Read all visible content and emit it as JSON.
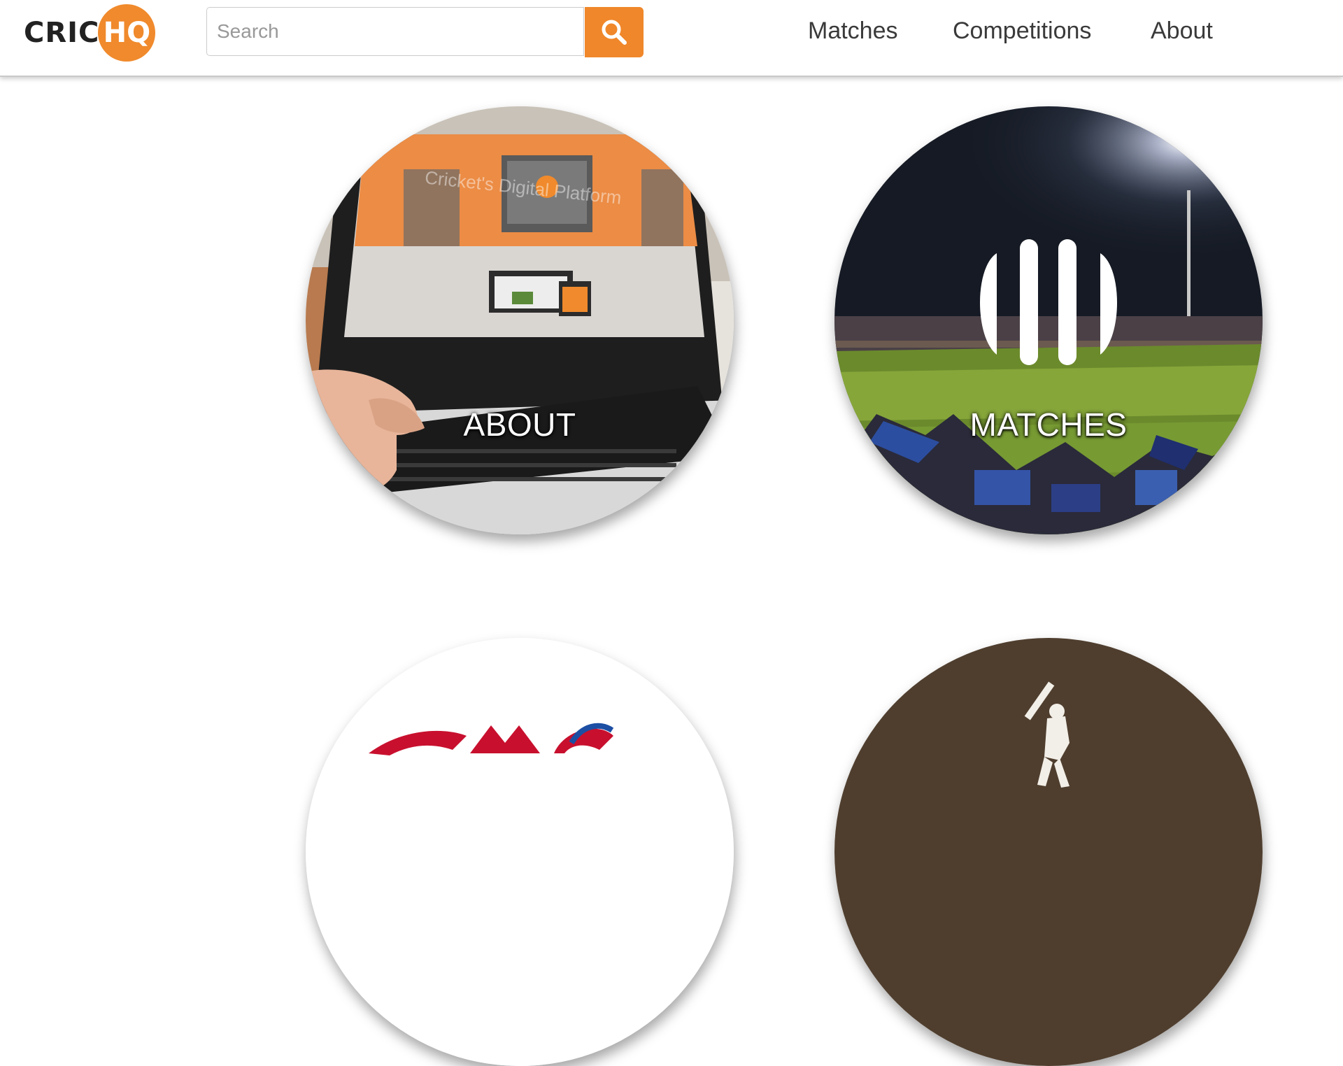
{
  "header": {
    "logo": {
      "prefix": "CRIC",
      "suffix": "HQ"
    },
    "search": {
      "placeholder": "Search",
      "value": "",
      "icon": "search-icon"
    },
    "nav": [
      {
        "label": "Matches"
      },
      {
        "label": "Competitions"
      },
      {
        "label": "About"
      }
    ]
  },
  "tiles": [
    {
      "label": "ABOUT"
    },
    {
      "label": "MATCHES"
    }
  ],
  "colors": {
    "brand_orange": "#f08a2c",
    "nav_text": "#3a3a3a",
    "bat_tile_bg": "#4f3e2e"
  }
}
